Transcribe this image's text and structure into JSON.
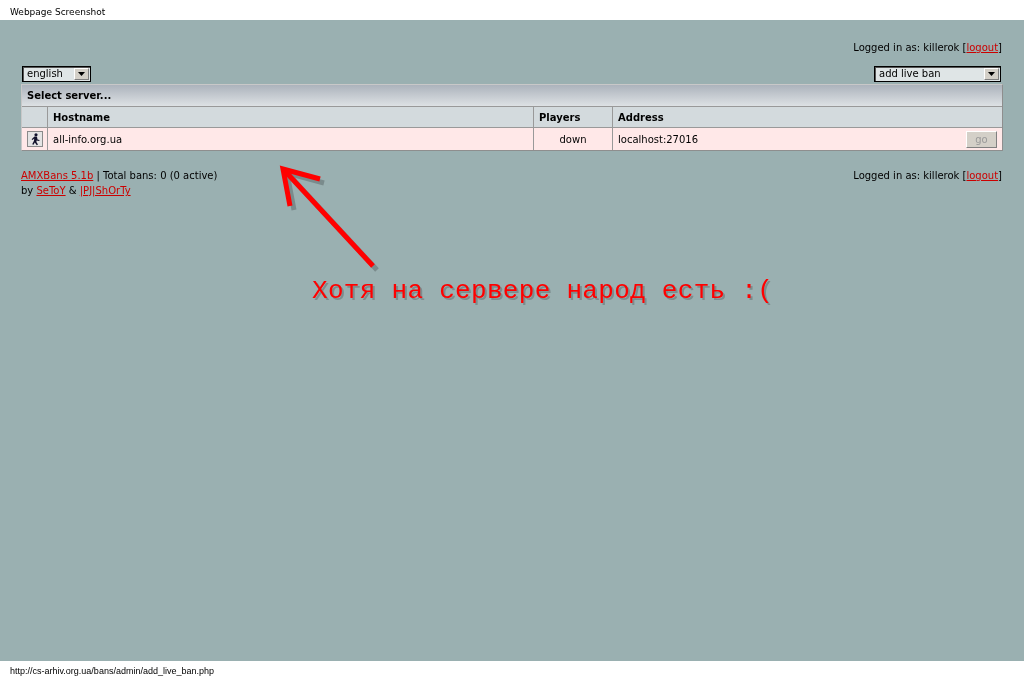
{
  "capture": {
    "title": "Webpage Screenshot",
    "url": "http://cs-arhiv.org.ua/bans/admin/add_live_ban.php"
  },
  "login_top": [
    {
      "kind": "text",
      "text": "Logged in as: killerok ["
    },
    {
      "kind": "link",
      "text": "logout"
    },
    {
      "kind": "text",
      "text": "]"
    }
  ],
  "language_select": {
    "value": "english"
  },
  "action_select": {
    "value": "add live ban"
  },
  "server_table": {
    "title": "Select server...",
    "columns": [
      "Hostname",
      "Players",
      "Address"
    ],
    "rows": [
      {
        "hostname": "all-info.org.ua",
        "players": "down",
        "address": "localhost:27016",
        "action": {
          "label": "go",
          "disabled": true
        }
      }
    ]
  },
  "footer": {
    "stats": [
      {
        "kind": "link",
        "text": "AMXBans 5.1b"
      },
      {
        "kind": "text",
        "text": " | Total bans: 0 (0 active)"
      }
    ],
    "credits": [
      {
        "kind": "text",
        "text": "by "
      },
      {
        "kind": "link",
        "text": "SeToY"
      },
      {
        "kind": "text",
        "text": " & "
      },
      {
        "kind": "link",
        "text": "|PJ|ShOrTy"
      }
    ],
    "login": [
      {
        "kind": "text",
        "text": "Logged in as: killerok ["
      },
      {
        "kind": "link",
        "text": "logout"
      },
      {
        "kind": "text",
        "text": "]"
      }
    ]
  },
  "annotation": {
    "text": "Хотя на сервере народ есть :("
  }
}
